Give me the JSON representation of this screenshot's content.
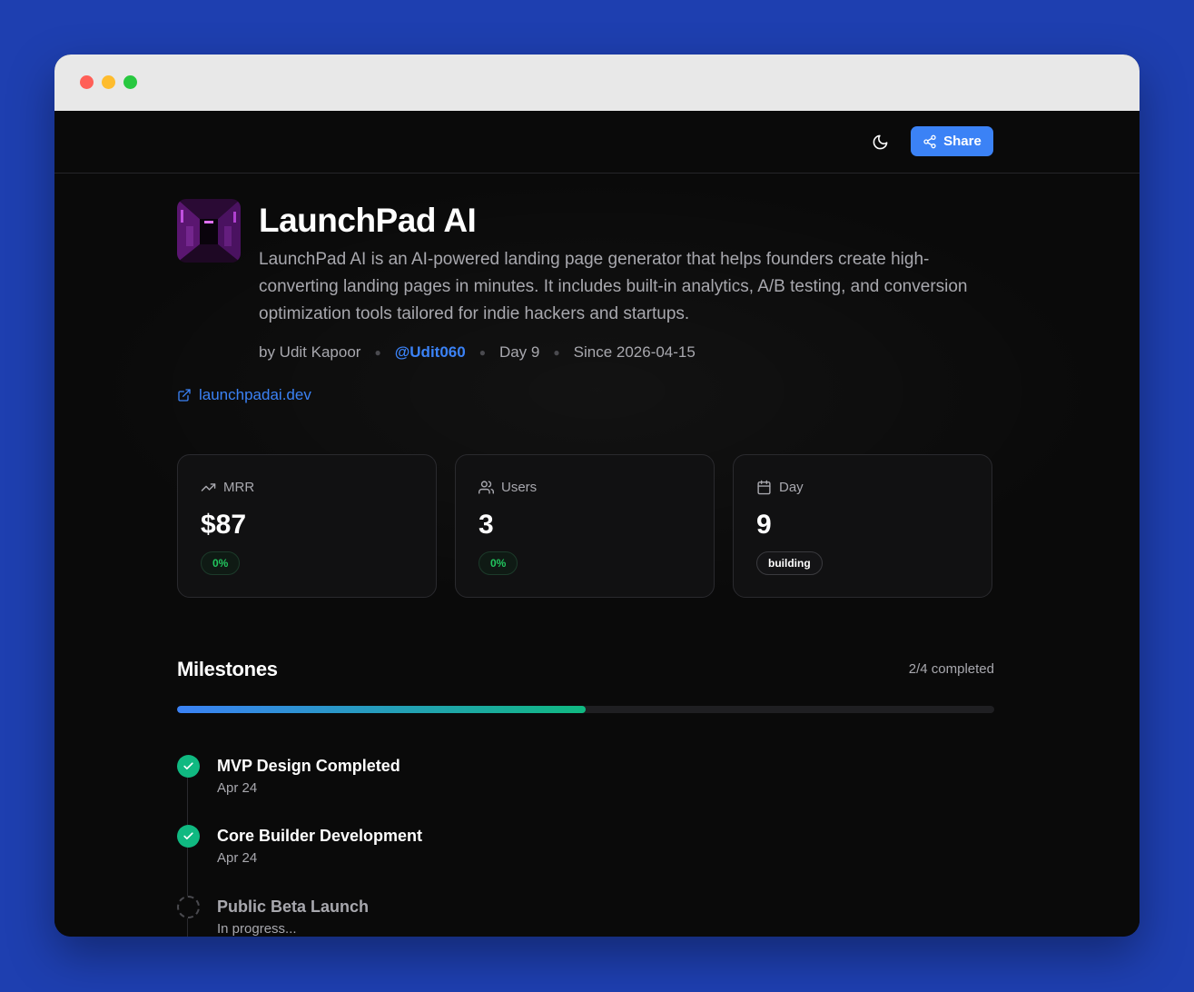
{
  "header": {
    "share_label": "Share"
  },
  "project": {
    "title": "LaunchPad AI",
    "description": "LaunchPad AI is an AI-powered landing page generator that helps founders create high-converting landing pages in minutes. It includes built-in analytics, A/B testing, and conversion optimization tools tailored for indie hackers and startups.",
    "author": "by Udit Kapoor",
    "handle": "@Udit060",
    "day": "Day 9",
    "since": "Since 2026-04-15",
    "website": "launchpadai.dev"
  },
  "stats": [
    {
      "label": "MRR",
      "value": "$87",
      "badge": "0%",
      "icon": "trending-up-icon"
    },
    {
      "label": "Users",
      "value": "3",
      "badge": "0%",
      "icon": "users-icon"
    },
    {
      "label": "Day",
      "value": "9",
      "badge": "building",
      "icon": "calendar-icon"
    }
  ],
  "milestones": {
    "title": "Milestones",
    "completed_text": "2/4 completed",
    "progress": 0.5,
    "items": [
      {
        "name": "MVP Design Completed",
        "date": "Apr 24",
        "status": "done"
      },
      {
        "name": "Core Builder Development",
        "date": "Apr 24",
        "status": "done"
      },
      {
        "name": "Public Beta Launch",
        "date": "In progress...",
        "status": "in-progress"
      }
    ]
  },
  "colors": {
    "accent": "#3b82f6",
    "success": "#10b981",
    "background": "#0a0a0a",
    "outer_background": "#1e3fb0"
  }
}
